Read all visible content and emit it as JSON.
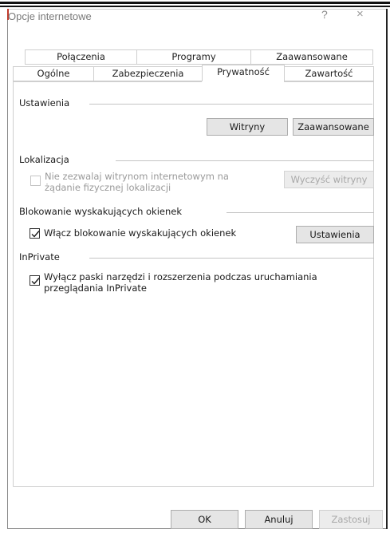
{
  "window": {
    "title": "Opcje internetowe",
    "help_icon": "?",
    "close_icon": "×"
  },
  "tabs": {
    "row1": [
      "Połączenia",
      "Programy",
      "Zaawansowane"
    ],
    "row2": [
      "Ogólne",
      "Zabezpieczenia",
      "Prywatność",
      "Zawartość"
    ],
    "active": "Prywatność"
  },
  "settings": {
    "group_label": "Ustawienia",
    "sites_button": "Witryny",
    "advanced_button": "Zaawansowane"
  },
  "location": {
    "group_label": "Lokalizacja",
    "checkbox_label_line1": "Nie zezwalaj witrynom internetowym na",
    "checkbox_label_line2": "żądanie fizycznej lokalizacji",
    "checked": false,
    "clear_button": "Wyczyść witryny"
  },
  "popup": {
    "group_label": "Blokowanie wyskakujących okienek",
    "checkbox_label": "Włącz blokowanie wyskakujących okienek",
    "checked": true,
    "settings_button": "Ustawienia"
  },
  "inprivate": {
    "group_label": "InPrivate",
    "checkbox_label_line1": "Wyłącz paski narzędzi i rozszerzenia podczas uruchamiania",
    "checkbox_label_line2": "przeglądania InPrivate",
    "checked": true
  },
  "footer": {
    "ok": "OK",
    "cancel": "Anuluj",
    "apply": "Zastosuj"
  }
}
